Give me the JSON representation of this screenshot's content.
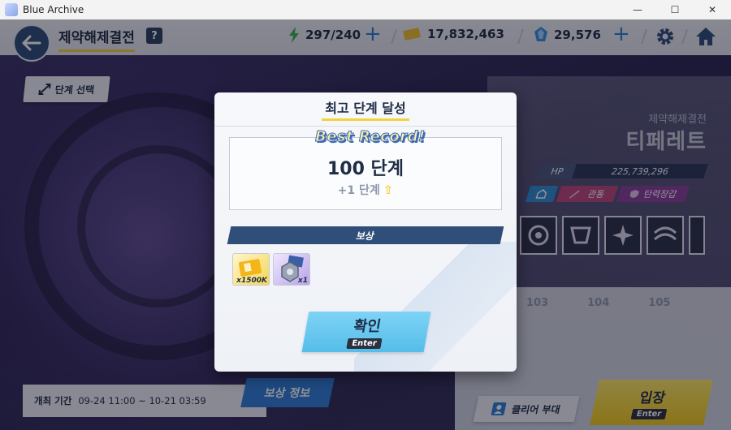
{
  "window": {
    "title": "Blue Archive",
    "minimize": "—",
    "maximize": "☐",
    "close": "✕"
  },
  "topbar": {
    "screen_title": "제약해제결전",
    "help": "?",
    "ap": "297/240",
    "credits": "17,832,463",
    "pyroxene": "29,576"
  },
  "stage_select": "단계 선택",
  "boss": {
    "subtitle": "제약해제결전",
    "name": "티페레트",
    "hp_label": "HP",
    "hp_value": "225,739,296",
    "tag_2": "관통",
    "tag_3": "탄력장갑"
  },
  "stage_numbers": [
    "103",
    "104",
    "105"
  ],
  "schedule": {
    "label": "개최 기간",
    "value": "09-24 11:00 ~ 10-21 03:59"
  },
  "reward_info_button": "보상 정보",
  "clear_team_button": "클리어 부대",
  "enter_button": {
    "label": "입장",
    "key": "Enter"
  },
  "modal": {
    "title": "최고 단계 달성",
    "badge": "Best Record!",
    "record": "100 단계",
    "record_delta": "+1 단계",
    "reward_header": "보상",
    "rewards": [
      {
        "icon": "credit-ticket-icon",
        "qty": "x1500K"
      },
      {
        "icon": "blueprint-icon",
        "qty": "x1"
      }
    ],
    "confirm": {
      "label": "확인",
      "key": "Enter"
    }
  },
  "colors": {
    "accent_yellow": "#f3d23c",
    "navy": "#2f4e78",
    "confirm_blue": "#54bde9"
  }
}
